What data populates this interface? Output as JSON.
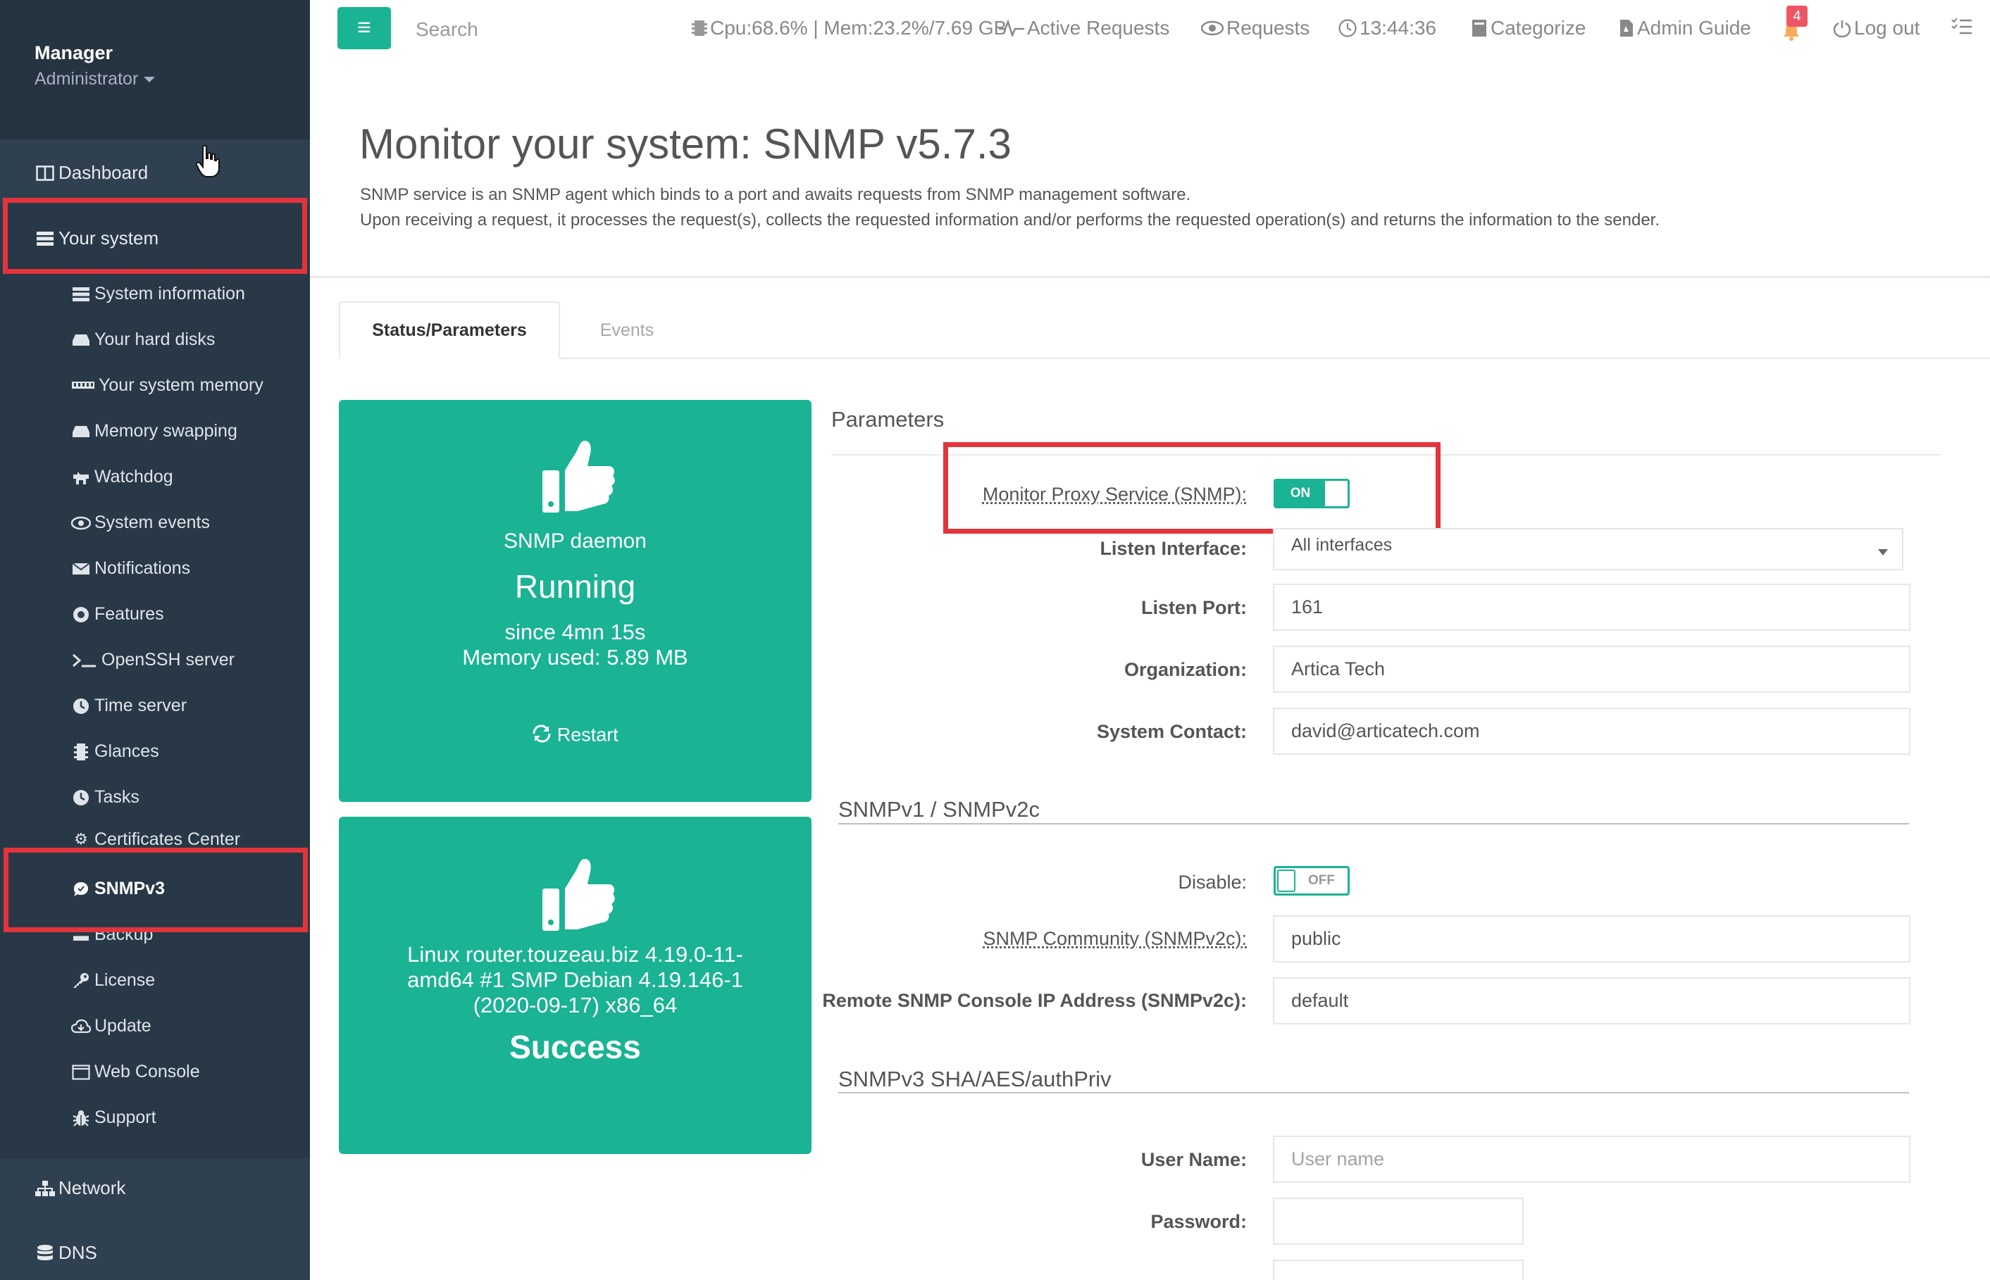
{
  "profile": {
    "name": "Manager",
    "role": "Administrator"
  },
  "nav": {
    "dashboard": "Dashboard",
    "your_system": "Your system",
    "network": "Network",
    "dns": "DNS",
    "sub_items": [
      {
        "label": "System information",
        "icon": "server-icon"
      },
      {
        "label": "Your hard disks",
        "icon": "hdd-icon"
      },
      {
        "label": "Your system memory",
        "icon": "memory-icon"
      },
      {
        "label": "Memory swapping",
        "icon": "hdd-icon"
      },
      {
        "label": "Watchdog",
        "icon": "watchdog-icon"
      },
      {
        "label": "System events",
        "icon": "eye-icon"
      },
      {
        "label": "Notifications",
        "icon": "envelope-icon"
      },
      {
        "label": "Features",
        "icon": "features-icon"
      },
      {
        "label": "OpenSSH server",
        "icon": "terminal-icon"
      },
      {
        "label": "Time server",
        "icon": "clock-icon"
      },
      {
        "label": "Glances",
        "icon": "glances-icon"
      },
      {
        "label": "Tasks",
        "icon": "clock-icon"
      },
      {
        "label": "Certificates Center",
        "icon": "gear-icon"
      },
      {
        "label": "SNMPv3",
        "icon": "chat-icon"
      },
      {
        "label": "Backup",
        "icon": "backup-icon"
      },
      {
        "label": "License",
        "icon": "key-icon"
      },
      {
        "label": "Update",
        "icon": "cloud-download-icon"
      },
      {
        "label": "Web Console",
        "icon": "window-icon"
      },
      {
        "label": "Support",
        "icon": "bug-icon"
      }
    ]
  },
  "topbar": {
    "search_placeholder": "Search",
    "cpu_mem": "Cpu:68.6% | Mem:23.2%/7.69 GB",
    "active_requests": "Active Requests",
    "requests": "Requests",
    "time": "13:44:36",
    "categorize": "Categorize",
    "admin_guide": "Admin Guide",
    "notifications_count": "4",
    "logout": "Log out"
  },
  "header": {
    "title": "Monitor your system: SNMP v5.7.3",
    "line1": "SNMP service is an SNMP agent which binds to a port and awaits requests from SNMP management software.",
    "line2": "Upon receiving a request, it processes the request(s), collects the requested information and/or performs the requested operation(s) and returns the information to the sender."
  },
  "tabs": {
    "status": "Status/Parameters",
    "events": "Events"
  },
  "status_widget": {
    "title": "SNMP daemon",
    "state": "Running",
    "since": "since 4mn 15s",
    "memory": "Memory used: 5.89 MB",
    "restart": "Restart"
  },
  "system_widget": {
    "line1": "Linux router.touzeau.biz 4.19.0-11-",
    "line2": "amd64 #1 SMP Debian 4.19.146-1",
    "line3": "(2020-09-17) x86_64",
    "result": "Success"
  },
  "params": {
    "title": "Parameters",
    "monitor_label": "Monitor Proxy Service (SNMP):",
    "monitor_value": "ON",
    "listen_interface_label": "Listen Interface:",
    "listen_interface_value": "All interfaces",
    "listen_port_label": "Listen Port:",
    "listen_port_value": "161",
    "organization_label": "Organization:",
    "organization_value": "Artica Tech",
    "contact_label": "System Contact:",
    "contact_value": "david@articatech.com",
    "snmpv2_title": "SNMPv1 / SNMPv2c",
    "disable_label": "Disable:",
    "disable_value": "OFF",
    "community_label": "SNMP Community (SNMPv2c):",
    "community_value": "public",
    "remote_label": "Remote SNMP Console IP Address (SNMPv2c):",
    "remote_value": "default",
    "snmpv3_title": "SNMPv3 SHA/AES/authPriv",
    "username_label": "User Name:",
    "username_placeholder": "User name",
    "password_label": "Password:"
  },
  "colors": {
    "sidebar": "#2f4050",
    "accent": "#1ab394",
    "highlight": "#e3343c",
    "badge": "#ed5565"
  }
}
